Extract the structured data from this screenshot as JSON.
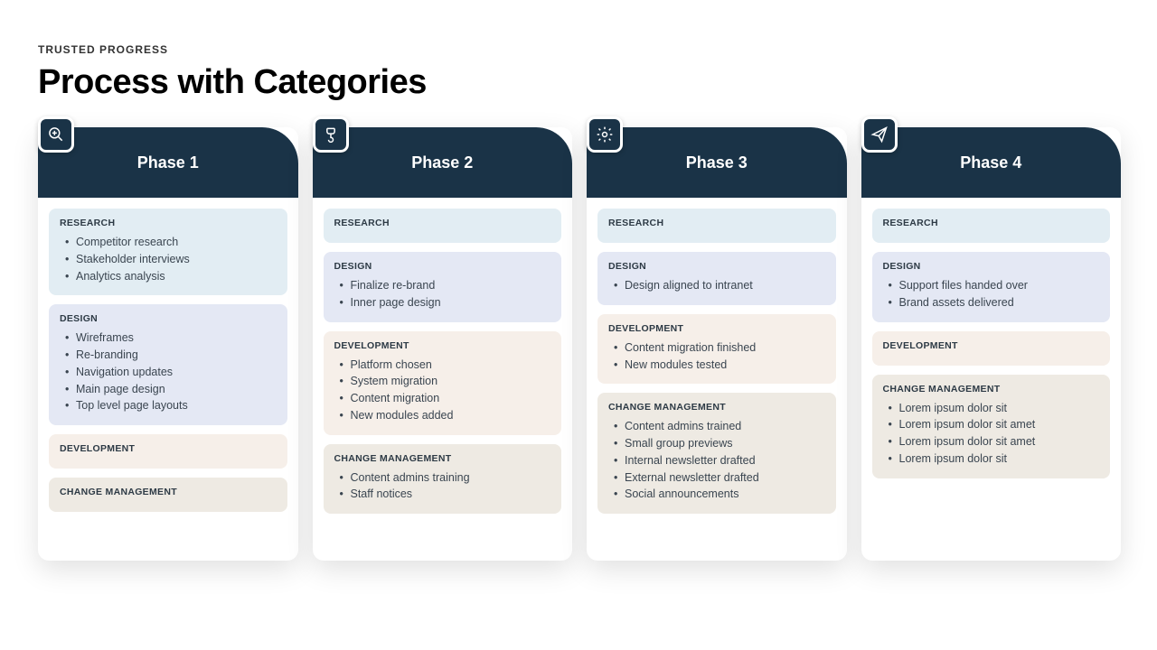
{
  "eyebrow": "TRUSTED PROGRESS",
  "title": "Process with Categories",
  "categories": {
    "research": "RESEARCH",
    "design": "DESIGN",
    "development": "DEVELOPMENT",
    "change": "CHANGE MANAGEMENT"
  },
  "phases": [
    {
      "title": "Phase 1",
      "icon": "zoom",
      "sections": [
        {
          "key": "research",
          "items": [
            "Competitor research",
            "Stakeholder interviews",
            "Analytics analysis"
          ]
        },
        {
          "key": "design",
          "items": [
            "Wireframes",
            "Re-branding",
            "Navigation updates",
            "Main page design",
            "Top level page layouts"
          ]
        },
        {
          "key": "development",
          "items": []
        },
        {
          "key": "change",
          "items": []
        }
      ]
    },
    {
      "title": "Phase 2",
      "icon": "brush",
      "sections": [
        {
          "key": "research",
          "items": []
        },
        {
          "key": "design",
          "items": [
            "Finalize re-brand",
            "Inner page design"
          ]
        },
        {
          "key": "development",
          "items": [
            "Platform chosen",
            "System migration",
            "Content migration",
            "New modules added"
          ]
        },
        {
          "key": "change",
          "items": [
            "Content admins training",
            "Staff notices"
          ]
        }
      ]
    },
    {
      "title": "Phase 3",
      "icon": "gear",
      "sections": [
        {
          "key": "research",
          "items": []
        },
        {
          "key": "design",
          "items": [
            "Design aligned to intranet"
          ]
        },
        {
          "key": "development",
          "items": [
            "Content migration finished",
            "New modules tested"
          ]
        },
        {
          "key": "change",
          "items": [
            "Content admins trained",
            "Small group previews",
            "Internal newsletter drafted",
            "External newsletter drafted",
            "Social announcements"
          ]
        }
      ]
    },
    {
      "title": "Phase 4",
      "icon": "send",
      "sections": [
        {
          "key": "research",
          "items": []
        },
        {
          "key": "design",
          "items": [
            "Support files handed over",
            "Brand assets delivered"
          ]
        },
        {
          "key": "development",
          "items": []
        },
        {
          "key": "change",
          "items": [
            "Lorem ipsum dolor sit",
            "Lorem ipsum dolor sit amet",
            "Lorem ipsum dolor sit amet",
            "Lorem ipsum dolor sit"
          ]
        }
      ]
    }
  ],
  "colors": {
    "header": "#1a3347",
    "research": "#e2edf3",
    "design": "#e4e8f4",
    "development": "#f6efe9",
    "change": "#eeeae3"
  }
}
